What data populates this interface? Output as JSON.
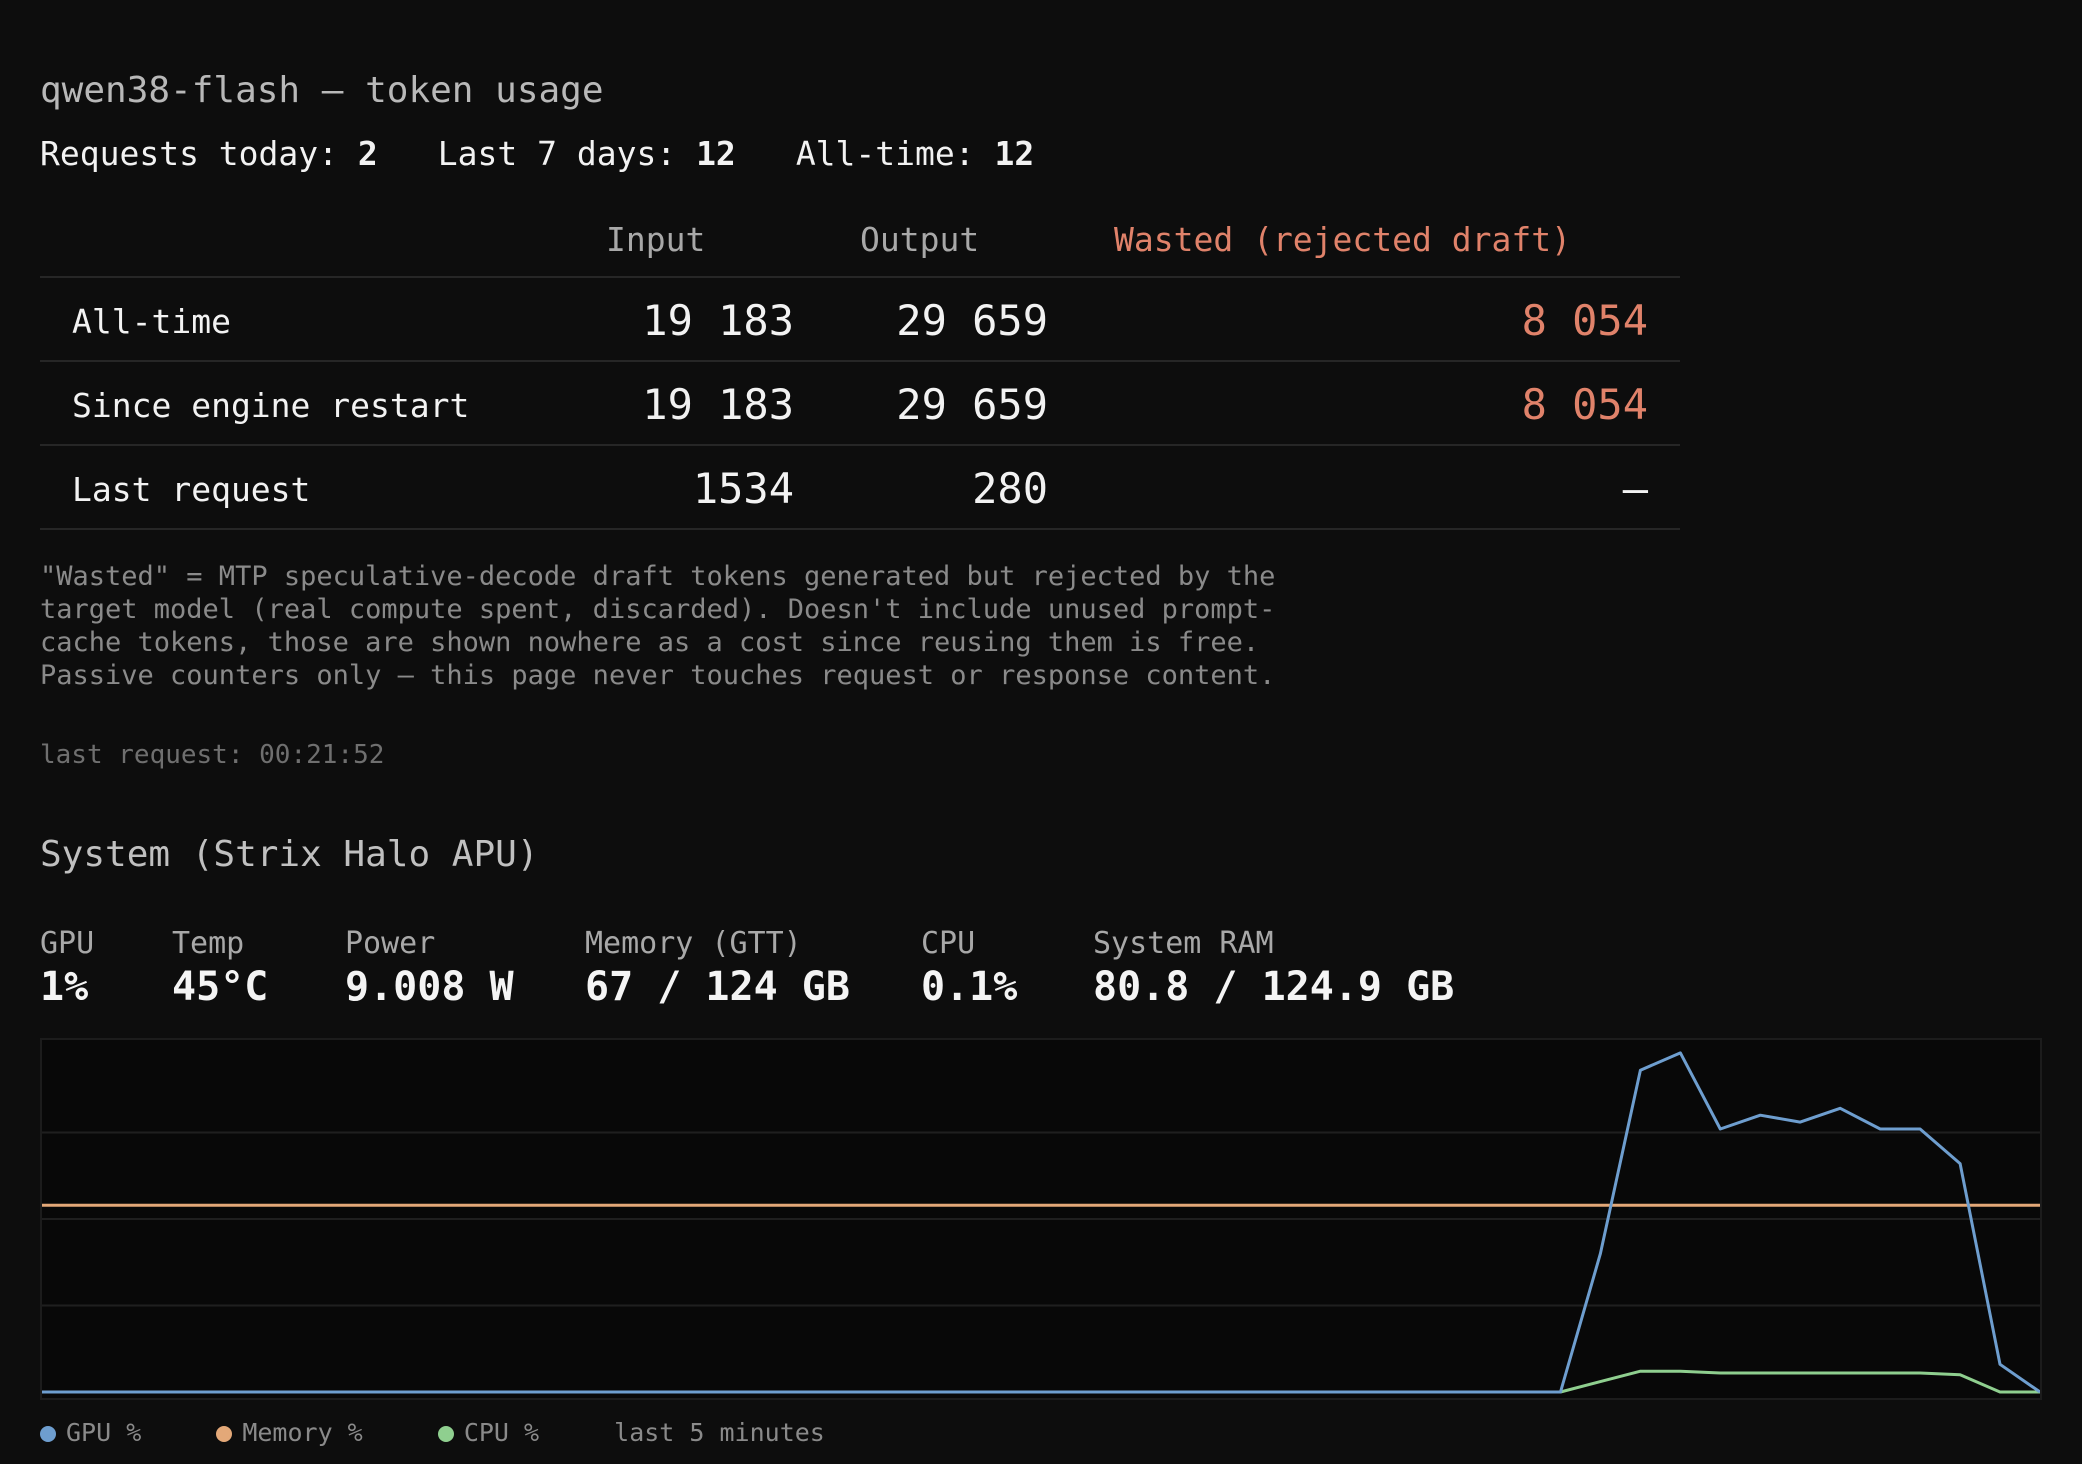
{
  "header": {
    "title": "qwen38-flash — token usage",
    "requests_today_label": "Requests today:",
    "requests_today": "2",
    "last7_label": "Last 7 days:",
    "last7": "12",
    "alltime_label": "All-time:",
    "alltime": "12"
  },
  "table": {
    "columns": {
      "input": "Input",
      "output": "Output",
      "wasted": "Wasted (rejected draft)"
    },
    "rows": [
      {
        "label": "All-time",
        "input": "19 183",
        "output": "29 659",
        "wasted": "8 054"
      },
      {
        "label": "Since engine restart",
        "input": "19 183",
        "output": "29 659",
        "wasted": "8 054"
      },
      {
        "label": "Last request",
        "input": "1534",
        "output": "280",
        "wasted": "—"
      }
    ]
  },
  "note": "\"Wasted\" = MTP speculative-decode draft tokens generated but rejected by the target model (real compute spent, discarded). Doesn't include unused prompt-cache tokens, those are shown nowhere as a cost since reusing them is free. Passive counters only — this page never touches request or response content.",
  "last_request": "last request: 00:21:52",
  "system": {
    "title": "System (Strix Halo APU)",
    "metrics": {
      "gpu": {
        "label": "GPU",
        "value": "1%"
      },
      "temp": {
        "label": "Temp",
        "value": "45°C"
      },
      "power": {
        "label": "Power",
        "value": "9.008 W"
      },
      "memory": {
        "label": "Memory (GTT)",
        "value": "67 / 124 GB"
      },
      "cpu": {
        "label": "CPU",
        "value": "0.1%"
      },
      "ram": {
        "label": "System RAM",
        "value": "80.8 / 124.9 GB"
      }
    }
  },
  "legend": {
    "gpu": "GPU %",
    "memory": "Memory %",
    "cpu": "CPU %",
    "window": "last 5 minutes"
  },
  "colors": {
    "gpu": "#6e9ecf",
    "memory": "#e3a878",
    "cpu": "#8fcf8f",
    "wasted": "#e0826a"
  },
  "chart_data": {
    "type": "line",
    "ylim": [
      0,
      100
    ],
    "grid": true,
    "x": [
      0,
      1,
      2,
      3,
      4,
      5,
      6,
      7,
      8,
      9,
      10,
      11,
      12,
      13,
      14,
      15,
      16,
      17,
      18,
      19,
      20,
      21,
      22,
      23,
      24,
      25,
      26,
      27,
      28,
      29,
      30,
      31,
      32,
      33,
      34,
      35,
      36,
      37,
      38,
      39,
      40,
      41,
      42,
      43,
      44,
      45,
      46,
      47,
      48,
      49,
      50
    ],
    "series": [
      {
        "name": "GPU %",
        "values": [
          0,
          0,
          0,
          0,
          0,
          0,
          0,
          0,
          0,
          0,
          0,
          0,
          0,
          0,
          0,
          0,
          0,
          0,
          0,
          0,
          0,
          0,
          0,
          0,
          0,
          0,
          0,
          0,
          0,
          0,
          0,
          0,
          0,
          0,
          0,
          0,
          0,
          0,
          0,
          40,
          93,
          98,
          76,
          80,
          78,
          82,
          76,
          76,
          66,
          8,
          0
        ]
      },
      {
        "name": "Memory %",
        "values": [
          54,
          54,
          54,
          54,
          54,
          54,
          54,
          54,
          54,
          54,
          54,
          54,
          54,
          54,
          54,
          54,
          54,
          54,
          54,
          54,
          54,
          54,
          54,
          54,
          54,
          54,
          54,
          54,
          54,
          54,
          54,
          54,
          54,
          54,
          54,
          54,
          54,
          54,
          54,
          54,
          54,
          54,
          54,
          54,
          54,
          54,
          54,
          54,
          54,
          54,
          54
        ]
      },
      {
        "name": "CPU %",
        "values": [
          0,
          0,
          0,
          0,
          0,
          0,
          0,
          0,
          0,
          0,
          0,
          0,
          0,
          0,
          0,
          0,
          0,
          0,
          0,
          0,
          0,
          0,
          0,
          0,
          0,
          0,
          0,
          0,
          0,
          0,
          0,
          0,
          0,
          0,
          0,
          0,
          0,
          0,
          0,
          3,
          6,
          6,
          5.5,
          5.5,
          5.5,
          5.5,
          5.5,
          5.5,
          5,
          0,
          0
        ]
      }
    ]
  }
}
